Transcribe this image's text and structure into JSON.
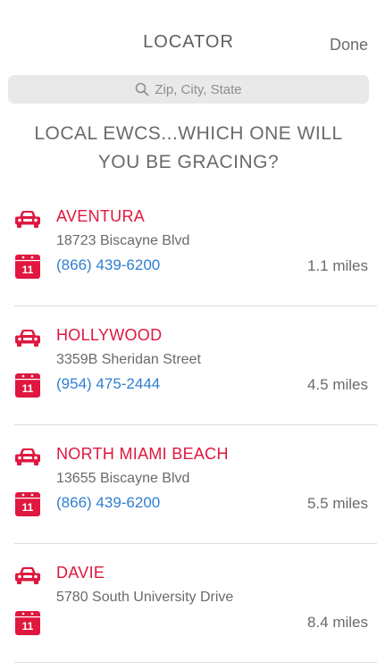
{
  "nav": {
    "title": "LOCATOR",
    "done_label": "Done"
  },
  "search": {
    "placeholder": "Zip, City, State"
  },
  "headline": {
    "line1": "LOCAL EWCS...WHICH ONE WILL",
    "line2": "YOU BE GRACING?"
  },
  "colors": {
    "accent": "#e0173f",
    "link": "#2f7fd0",
    "text": "#6a6a6a"
  },
  "icons": {
    "car": "car-icon",
    "calendar": "calendar-icon",
    "search": "search-icon"
  },
  "calendar_day": "11",
  "locations": [
    {
      "name": "AVENTURA",
      "address": "18723 Biscayne Blvd",
      "phone": "(866) 439-6200",
      "distance": "1.1 miles"
    },
    {
      "name": "HOLLYWOOD",
      "address": "3359B Sheridan Street",
      "phone": "(954) 475-2444",
      "distance": "4.5 miles"
    },
    {
      "name": "NORTH MIAMI BEACH",
      "address": "13655 Biscayne Blvd",
      "phone": "(866) 439-6200",
      "distance": "5.5 miles"
    },
    {
      "name": "DAVIE",
      "address": "5780 South University Drive",
      "phone": "",
      "distance": "8.4 miles"
    }
  ]
}
